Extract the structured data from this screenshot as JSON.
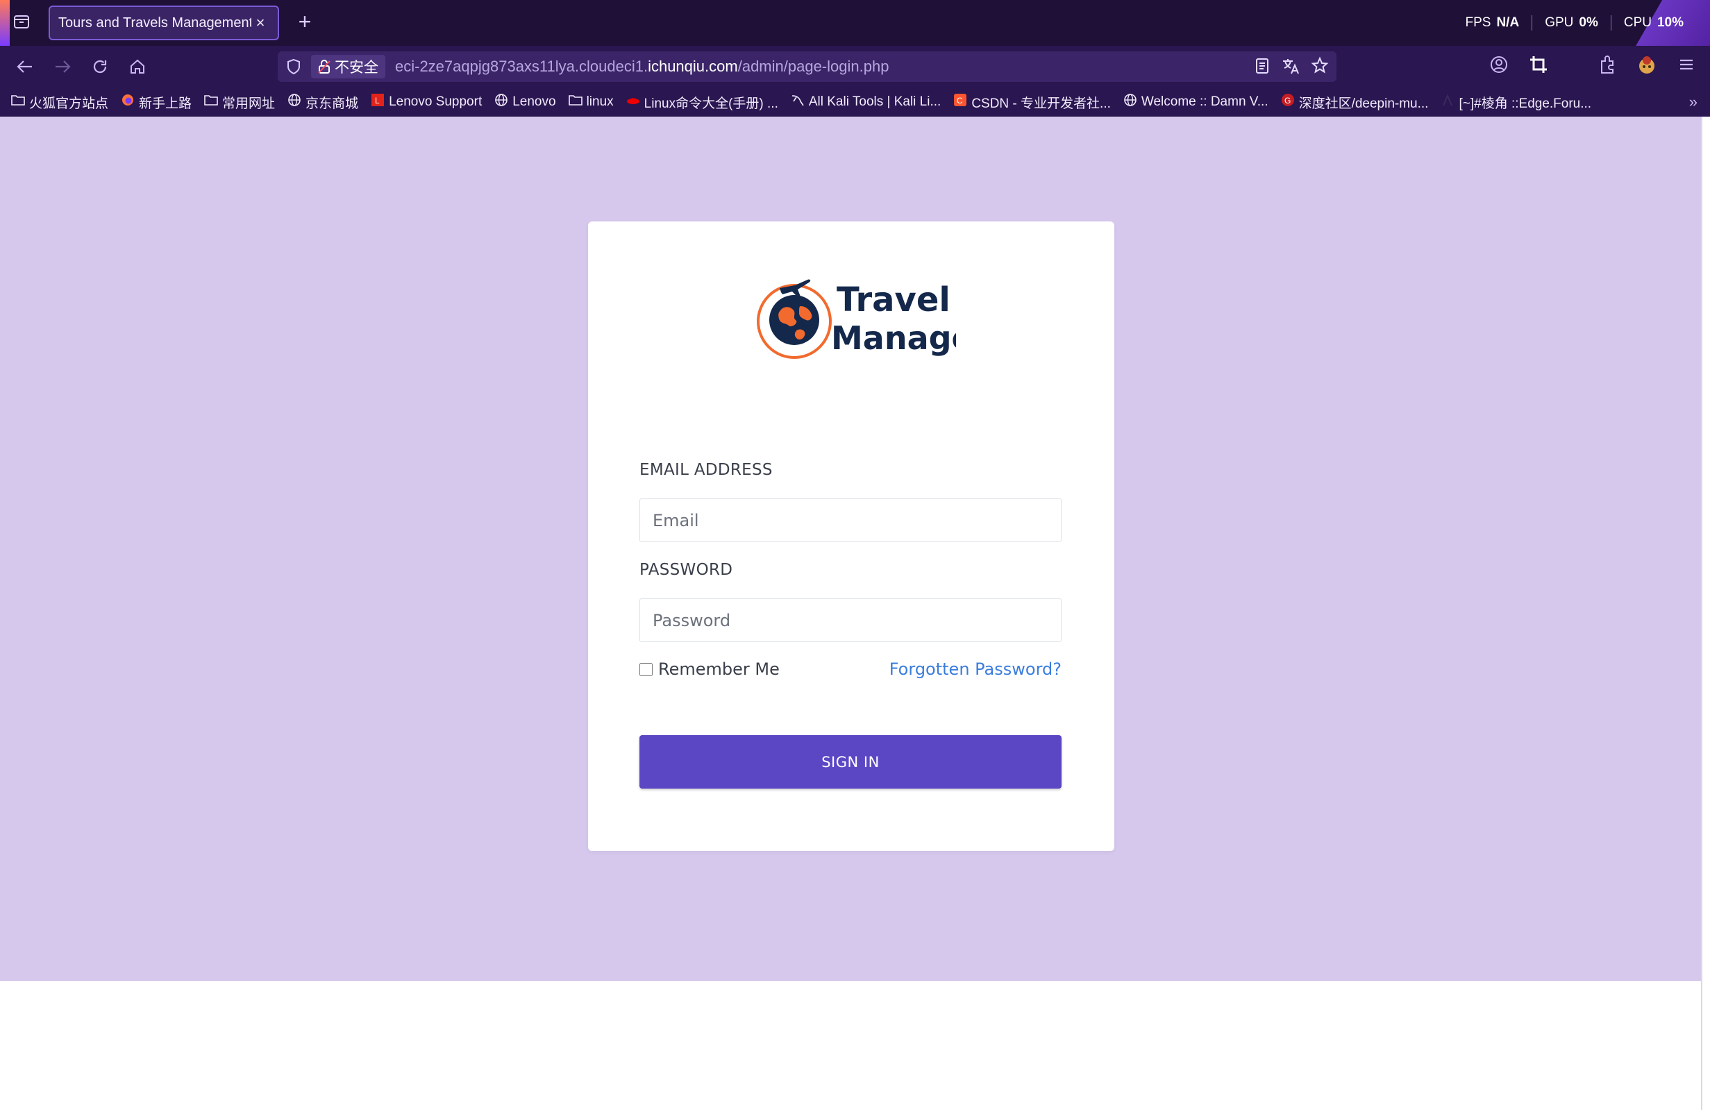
{
  "browser": {
    "tab_title": "Tours and Travels Management S",
    "tab_close": "×",
    "new_tab": "+",
    "perf": {
      "fps_label": "FPS",
      "fps_value": "N/A",
      "gpu_label": "GPU",
      "gpu_value": "0%",
      "cpu_label": "CPU",
      "cpu_value": "10%"
    },
    "security_label": "不安全",
    "url_prefix": "eci-2ze7aqpjg873axs11lya.cloudeci1.",
    "url_domain": "ichunqiu.com",
    "url_path": "/admin/page-login.php",
    "bookmarks": [
      {
        "label": "火狐官方站点",
        "icon": "folder-icon"
      },
      {
        "label": "新手上路",
        "icon": "firefox-icon"
      },
      {
        "label": "常用网址",
        "icon": "folder-icon"
      },
      {
        "label": "京东商城",
        "icon": "globe-icon"
      },
      {
        "label": "Lenovo Support",
        "icon": "lenovo-icon"
      },
      {
        "label": "Lenovo",
        "icon": "globe-icon"
      },
      {
        "label": "linux",
        "icon": "folder-icon"
      },
      {
        "label": "Linux命令大全(手册) ...",
        "icon": "redhat-icon"
      },
      {
        "label": "All Kali Tools | Kali Li...",
        "icon": "kali-icon"
      },
      {
        "label": "CSDN - 专业开发者社...",
        "icon": "csdn-icon"
      },
      {
        "label": "Welcome :: Damn V...",
        "icon": "globe-icon"
      },
      {
        "label": "深度社区/deepin-mu...",
        "icon": "gitee-icon"
      },
      {
        "label": "[~]#棱角 ::Edge.Foru...",
        "icon": "edge-icon"
      }
    ],
    "bookmarks_more": "»"
  },
  "login": {
    "logo_line1": "Travel",
    "logo_line2": "Manager",
    "email_label": "EMAIL ADDRESS",
    "email_placeholder": "Email",
    "password_label": "PASSWORD",
    "password_placeholder": "Password",
    "remember_label": "Remember Me",
    "forgot_label": "Forgotten Password?",
    "signin_label": "SIGN IN"
  },
  "colors": {
    "page_bg": "#d6c8ec",
    "button": "#5b47c4",
    "link": "#3b7ddd",
    "logo_navy": "#14284b",
    "logo_orange": "#f26a2e"
  }
}
